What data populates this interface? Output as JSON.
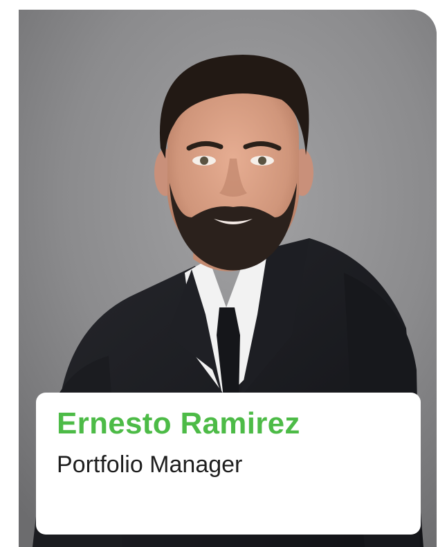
{
  "profile": {
    "name": "Ernesto Ramirez",
    "title": "Portfolio Manager"
  },
  "colors": {
    "name_accent": "#4dbb47",
    "background_gray": "#8c8c8e",
    "suit": "#1b1c20"
  }
}
